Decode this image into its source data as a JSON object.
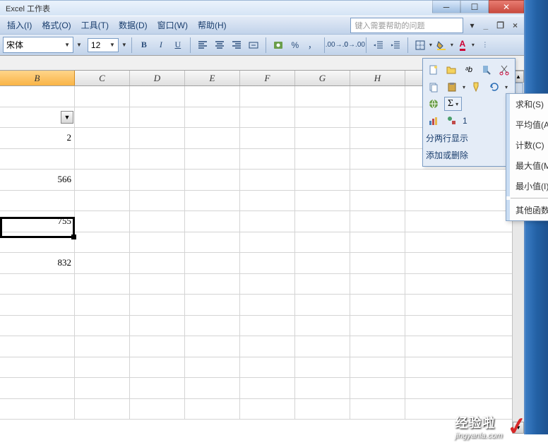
{
  "titlebar": {
    "title": "Excel 工作表"
  },
  "menu": {
    "insert": "插入(I)",
    "format": "格式(O)",
    "tools": "工具(T)",
    "data": "数据(D)",
    "window": "窗口(W)",
    "help": "帮助(H)"
  },
  "helpbox": {
    "placeholder": "键入需要帮助的问题"
  },
  "toolbar": {
    "font": "宋体",
    "size": "12",
    "bold": "B",
    "italic": "I",
    "underline": "U",
    "percent": "%",
    "comma": "，"
  },
  "columns": [
    "B",
    "C",
    "D",
    "E",
    "F",
    "G",
    "H",
    ""
  ],
  "cells": {
    "r3": "2",
    "r5": "566",
    "r7": "755",
    "r9": "832"
  },
  "panel": {
    "split": "分两行显示",
    "add": "添加或删除",
    "oneText": "1"
  },
  "autosum": {
    "sum": "求和(S)",
    "avg": "平均值(A)",
    "count": "计数(C)",
    "max": "最大值(M)",
    "min": "最小值(I)",
    "other": "其他函数(F)."
  },
  "watermark": {
    "top": "经验啦",
    "bottom": "jingyanla.com"
  }
}
